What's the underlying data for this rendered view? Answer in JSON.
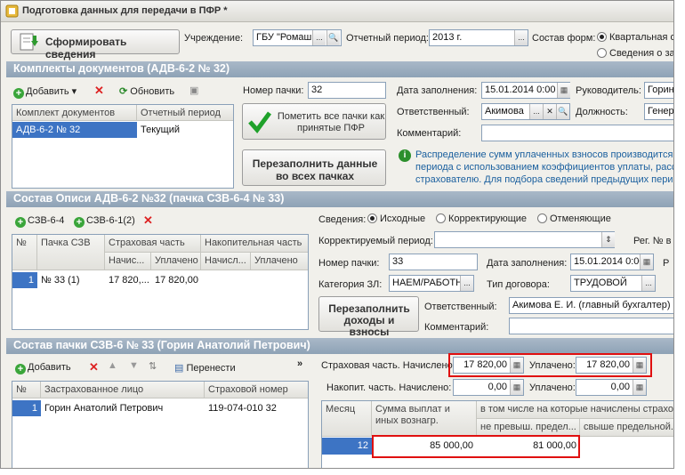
{
  "window": {
    "title": "Подготовка данных для передачи в ПФР *"
  },
  "top": {
    "generate_button": "Сформировать сведения",
    "institution_label": "Учреждение:",
    "institution_value": "ГБУ \"Ромаш",
    "period_label": "Отчетный период:",
    "period_value": "2013 г.",
    "forms_label": "Состав форм:",
    "forms_option1": "Квартальная о",
    "forms_option2": "Сведения о за"
  },
  "sets": {
    "header": "Комплекты документов     (АДВ-6-2 № 32)",
    "add": "Добавить",
    "refresh": "Обновить",
    "col_set": "Комплект документов",
    "col_period": "Отчетный период",
    "row_set": "АДВ-6-2 № 32",
    "row_period": "Текущий",
    "pack_no_label": "Номер пачки:",
    "pack_no_value": "32",
    "mark_button": "Пометить все пачки как принятые ПФР",
    "refill_button": "Перезаполнить данные во всех пачках",
    "fill_date_label": "Дата заполнения:",
    "fill_date_value": "15.01.2014 0:00",
    "head_label": "Руководитель:",
    "head_value": "Горин А",
    "responsible_label": "Ответственный:",
    "responsible_value": "Акимова",
    "position_label": "Должность:",
    "position_value": "Генера",
    "comment_label": "Комментарий:",
    "info_line1": "Распределение сумм уплаченных взносов производится",
    "info_line2": "периода с использованием коэффициентов уплаты, рассч",
    "info_line3": "страхователю. Для подбора сведений предыдущих период"
  },
  "inventory": {
    "header": "Состав Описи АДВ-6-2 №32     (пачка СЗВ-6-4 № 33)",
    "add1": "СЗВ-6-4",
    "add2": "СЗВ-6-1(2)",
    "col_no": "№",
    "col_pack": "Пачка СЗВ",
    "col_ins": "Страховая часть",
    "col_acc": "Накопительная часть",
    "sub_calc": "Начис...",
    "sub_paid": "Уплачено",
    "sub_calc2": "Начисл...",
    "sub_paid2": "Уплачено",
    "row_no": "1",
    "row_pack": "№ 33 (1)",
    "row_calc": "17 820,...",
    "row_paid": "17 820,00",
    "info_label": "Сведения:",
    "opt_initial": "Исходные",
    "opt_correcting": "Корректирующие",
    "opt_cancel": "Отменяющие",
    "corr_period_label": "Корректируемый период:",
    "reg_label": "Рег. № в",
    "pack_no_label": "Номер пачки:",
    "pack_no_value": "33",
    "fill_date_label": "Дата заполнения:",
    "fill_date_value": "15.01.2014 0:00",
    "r_label": "Р",
    "category_label": "Категория ЗЛ:",
    "category_value": "НАЕМ/РАБОТН",
    "contract_label": "Тип договора:",
    "contract_value": "ТРУДОВОЙ",
    "refill_button": "Перезаполнить доходы и взносы",
    "responsible_label": "Ответственный:",
    "responsible_value": "Акимова Е. И. (главный бухгалтер)",
    "comment_label": "Комментарий:"
  },
  "pack": {
    "header": "Состав пачки СЗВ-6 № 33     (Горин Анатолий Петрович)",
    "add": "Добавить",
    "transfer": "Перенести",
    "col_no": "№",
    "col_person": "Застрахованное лицо",
    "col_snils": "Страховой номер",
    "row_no": "1",
    "row_person": "Горин Анатолий Петрович",
    "row_snils": "119-074-010 32",
    "ins_calc_label": "Страховая часть. Начислено:",
    "ins_calc_value": "17 820,00",
    "ins_paid_label": "Уплачено:",
    "ins_paid_value": "17 820,00",
    "acc_calc_label": "Накопит. часть. Начислено:",
    "acc_calc_value": "0,00",
    "acc_paid_label": "Уплачено:",
    "acc_paid_value": "0,00",
    "col_month": "Месяц",
    "col_sum": "Сумма выплат и иных вознагр.",
    "col_including": "в том числе на которые начислены страхов",
    "col_not_exceed": "не превыш. предел...",
    "col_over": "свыше предельной...",
    "row_month": "12",
    "row_sum": "85 000,00",
    "row_not_exceed": "81 000,00"
  }
}
